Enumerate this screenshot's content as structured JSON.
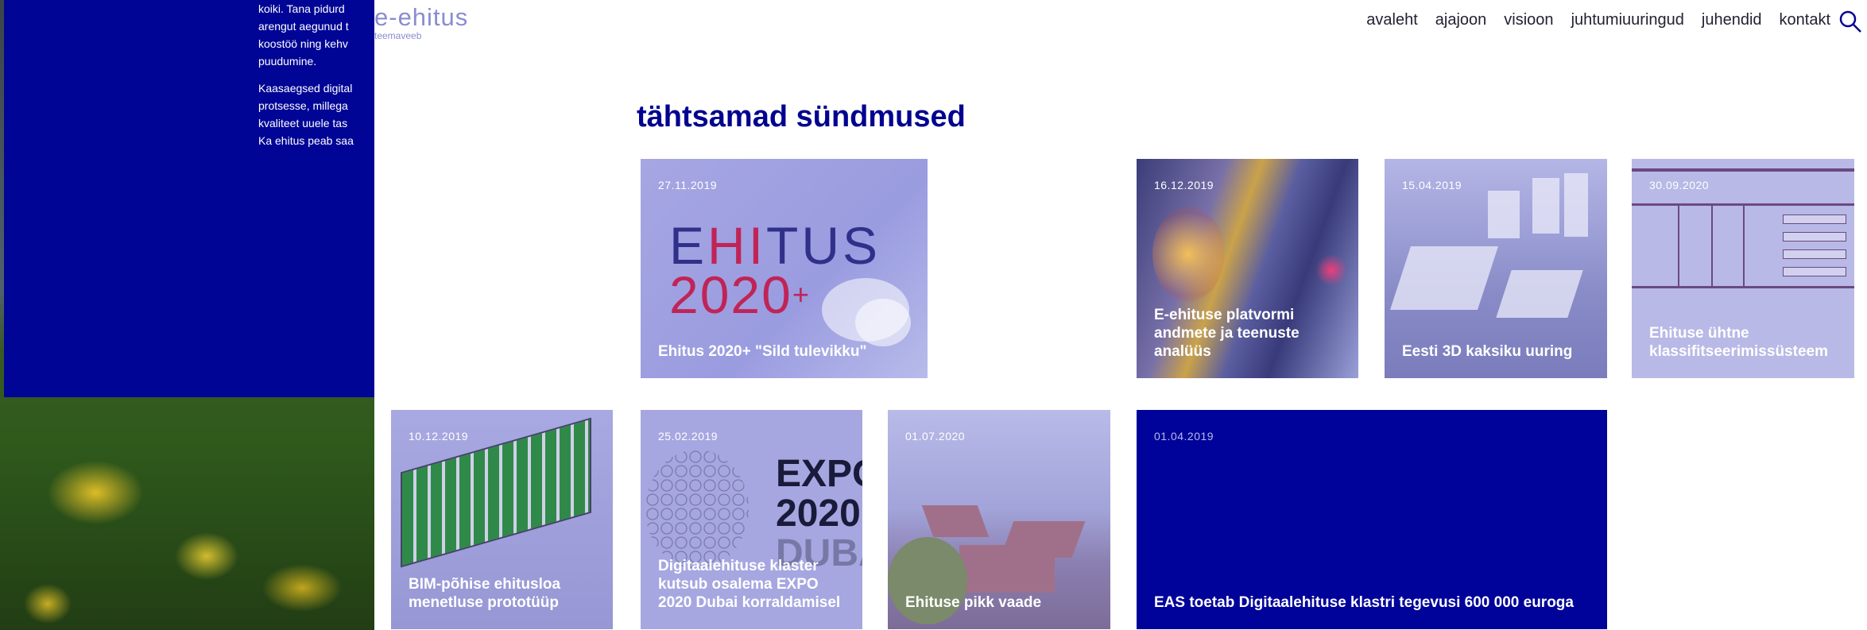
{
  "background": {
    "paragraphs": [
      "koiki. Tana pidurd",
      "arengut aegunud t",
      "koostöö ning kehv",
      "puudumine.",
      "Kaasaegsed digital",
      "protsesse, millega",
      "kvaliteet uuele tas",
      "Ka ehitus peab saa"
    ]
  },
  "header": {
    "logo_main": "e-ehitus",
    "logo_sub": "teemaveeb",
    "nav": [
      "avaleht",
      "ajajoon",
      "visioon",
      "juhtumiuuringud",
      "juhendid",
      "kontakt"
    ],
    "search_icon": "search-icon"
  },
  "section_title": "tähtsamad sündmused",
  "tiles": [
    {
      "date": "27.11.2019",
      "caption": "Ehitus 2020+ \"Sild tulevikku\"",
      "logo_line1_a": "E",
      "logo_line1_b": "HI",
      "logo_line1_c": "TUS",
      "logo_line2": "2020",
      "logo_plus": "+"
    },
    {
      "date": "16.12.2019",
      "caption": "E-ehituse platvormi andmete ja teenuste analüüs"
    },
    {
      "date": "15.04.2019",
      "caption": "Eesti 3D kaksiku uuring"
    },
    {
      "date": "30.09.2020",
      "caption": "Ehituse ühtne klassifitseerimissüsteem"
    },
    {
      "date": "10.12.2019",
      "caption": "BIM-põhise ehitusloa menetluse prototüüp"
    },
    {
      "date": "25.02.2019",
      "caption": "Digitaalehituse klaster kutsub osalema EXPO 2020 Dubai korraldamisel",
      "expo_line1": "EXPO",
      "expo_line2": "2020",
      "expo_line3": "DUBA"
    },
    {
      "date": "01.07.2020",
      "caption": "Ehituse pikk vaade"
    },
    {
      "date": "01.04.2019",
      "caption": "EAS toetab Digitaalehituse klastri tegevusi 600 000 euroga"
    }
  ],
  "colors": {
    "brand_blue": "#00038f",
    "tile_lilac": "#a6a7e0",
    "accent_red": "#c02457"
  }
}
